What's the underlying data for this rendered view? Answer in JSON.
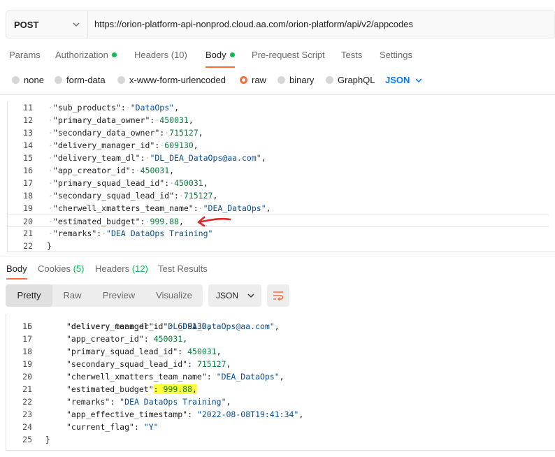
{
  "request": {
    "method": "POST",
    "url": "https://orion-platform-api-nonprod.cloud.aa.com/orion-platform/api/v2/appcodes"
  },
  "request_tabs": [
    {
      "label": "Params"
    },
    {
      "label": "Authorization"
    },
    {
      "label": "Headers (10)"
    },
    {
      "label": "Body"
    },
    {
      "label": "Pre-request Script"
    },
    {
      "label": "Tests"
    },
    {
      "label": "Settings"
    }
  ],
  "body_types": [
    {
      "label": "none"
    },
    {
      "label": "form-data"
    },
    {
      "label": "x-www-form-urlencoded"
    },
    {
      "label": "raw"
    },
    {
      "label": "binary"
    },
    {
      "label": "GraphQL"
    }
  ],
  "body_format": "JSON",
  "request_body_lines": [
    {
      "n": "11",
      "k": "\"sub_products\"",
      "p": ":",
      "v": "\"DataOps\"",
      "t": "str",
      "e": ","
    },
    {
      "n": "12",
      "k": "\"primary_data_owner\"",
      "p": ":",
      "v": "450031",
      "t": "num",
      "e": ","
    },
    {
      "n": "13",
      "k": "\"secondary_data_owner\"",
      "p": ":",
      "v": "715127",
      "t": "num",
      "e": ","
    },
    {
      "n": "14",
      "k": "\"delivery_manager_id\"",
      "p": ":",
      "v": "609130",
      "t": "num",
      "e": ","
    },
    {
      "n": "15",
      "k": "\"delivery_team_dl\"",
      "p": ":",
      "v": "\"DL_DEA_DataOps@aa.com\"",
      "t": "str",
      "e": ","
    },
    {
      "n": "16",
      "k": "\"app_creator_id\"",
      "p": ":",
      "v": "450031",
      "t": "num",
      "e": ","
    },
    {
      "n": "17",
      "k": "\"primary_squad_lead_id\"",
      "p": ":",
      "v": "450031",
      "t": "num",
      "e": ","
    },
    {
      "n": "18",
      "k": "\"secondary_squad_lead_id\"",
      "p": ":",
      "v": "715127",
      "t": "num",
      "e": ","
    },
    {
      "n": "19",
      "k": "\"cherwell_xmatters_team_name\"",
      "p": ":",
      "v": "\"DEA_DataOps\"",
      "t": "str",
      "e": ","
    },
    {
      "n": "20",
      "k": "\"estimated_budget\"",
      "p": ":",
      "v": "999.88",
      "t": "num",
      "e": ","
    },
    {
      "n": "21",
      "k": "\"remarks\"",
      "p": ":",
      "v": "\"DEA DataOps Training\"",
      "t": "str",
      "e": ""
    },
    {
      "n": "22",
      "k": "",
      "p": "",
      "v": "}",
      "t": "brace",
      "e": ""
    }
  ],
  "response_tabs": [
    {
      "label": "Body"
    },
    {
      "label": "Cookies",
      "count": "(5)"
    },
    {
      "label": "Headers",
      "count": "(12)"
    },
    {
      "label": "Test Results"
    }
  ],
  "response_views": [
    {
      "label": "Pretty"
    },
    {
      "label": "Raw"
    },
    {
      "label": "Preview"
    },
    {
      "label": "Visualize"
    }
  ],
  "response_format": "JSON",
  "response_partial_line": "\"delivery_manager_id\": 609130,",
  "response_lines": [
    {
      "n": "16",
      "k": "\"delivery_team_dl\"",
      "p": ":",
      "v": "\"DL_DEA_DataOps@aa.com\"",
      "t": "str",
      "e": ","
    },
    {
      "n": "17",
      "k": "\"app_creator_id\"",
      "p": ":",
      "v": "450031",
      "t": "num",
      "e": ","
    },
    {
      "n": "18",
      "k": "\"primary_squad_lead_id\"",
      "p": ":",
      "v": "450031",
      "t": "num",
      "e": ","
    },
    {
      "n": "19",
      "k": "\"secondary_squad_lead_id\"",
      "p": ":",
      "v": "715127",
      "t": "num",
      "e": ","
    },
    {
      "n": "20",
      "k": "\"cherwell_xmatters_team_name\"",
      "p": ":",
      "v": "\"DEA_DataOps\"",
      "t": "str",
      "e": ","
    },
    {
      "n": "21",
      "k": "\"estimated_budget\"",
      "p": ":",
      "v": "999.88",
      "t": "num",
      "e": ","
    },
    {
      "n": "22",
      "k": "\"remarks\"",
      "p": ":",
      "v": "\"DEA DataOps Training\"",
      "t": "str",
      "e": ","
    },
    {
      "n": "23",
      "k": "\"app_effective_timestamp\"",
      "p": ":",
      "v": "\"2022-08-08T19:41:34\"",
      "t": "str",
      "e": ","
    },
    {
      "n": "24",
      "k": "\"current_flag\"",
      "p": ":",
      "v": "\"Y\"",
      "t": "str",
      "e": ""
    },
    {
      "n": "25",
      "k": "",
      "p": "",
      "v": "}",
      "t": "brace",
      "e": ""
    }
  ],
  "colors": {
    "accent": "#ff6c37",
    "status_green": "#0cbb52",
    "link_blue": "#097bed",
    "annotation_arrow": "#e0262b",
    "annotation_highlight": "#ffff3d"
  }
}
